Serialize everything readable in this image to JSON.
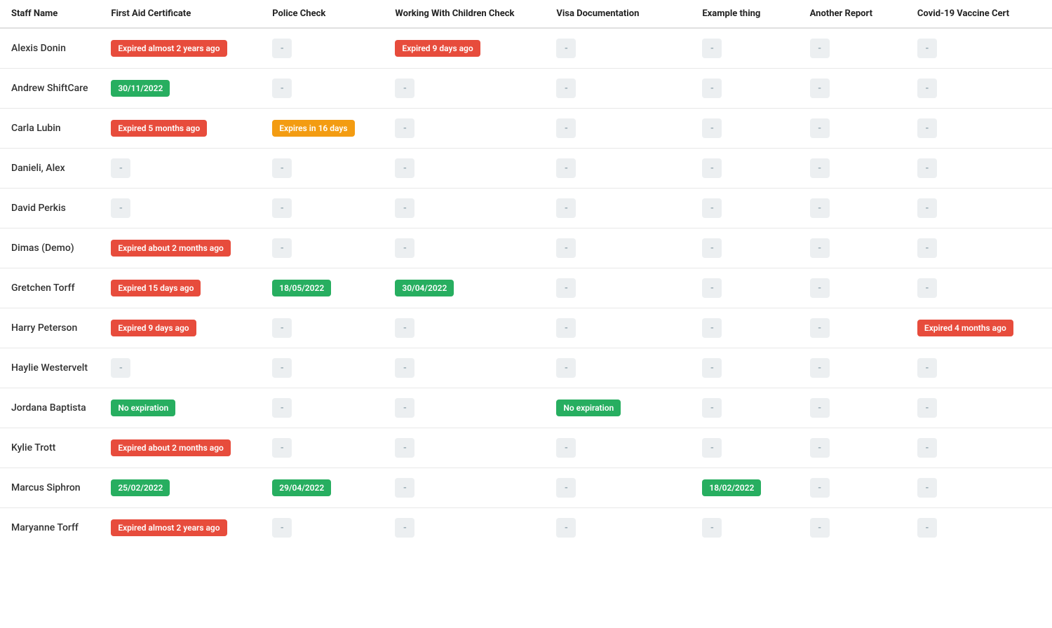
{
  "colors": {
    "red": "#e74c3c",
    "green": "#27ae60",
    "orange": "#f39c12",
    "empty_bg": "#eceff1",
    "empty_text": "#90a4ae"
  },
  "columns": [
    {
      "key": "name",
      "label": "Staff Name"
    },
    {
      "key": "first_aid",
      "label": "First Aid Certificate"
    },
    {
      "key": "police",
      "label": "Police Check"
    },
    {
      "key": "wwc",
      "label": "Working With Children Check"
    },
    {
      "key": "visa",
      "label": "Visa Documentation"
    },
    {
      "key": "example",
      "label": "Example thing"
    },
    {
      "key": "another",
      "label": "Another Report"
    },
    {
      "key": "covid",
      "label": "Covid-19 Vaccine Cert"
    }
  ],
  "rows": [
    {
      "name": "Alexis Donin",
      "first_aid": {
        "type": "red",
        "text": "Expired almost 2 years ago"
      },
      "police": {
        "type": "empty"
      },
      "wwc": {
        "type": "red",
        "text": "Expired 9 days ago"
      },
      "visa": {
        "type": "empty"
      },
      "example": {
        "type": "empty"
      },
      "another": {
        "type": "empty"
      },
      "covid": {
        "type": "empty"
      }
    },
    {
      "name": "Andrew ShiftCare",
      "first_aid": {
        "type": "green",
        "text": "30/11/2022"
      },
      "police": {
        "type": "empty"
      },
      "wwc": {
        "type": "empty"
      },
      "visa": {
        "type": "empty"
      },
      "example": {
        "type": "empty"
      },
      "another": {
        "type": "empty"
      },
      "covid": {
        "type": "empty"
      }
    },
    {
      "name": "Carla Lubin",
      "first_aid": {
        "type": "red",
        "text": "Expired 5 months ago"
      },
      "police": {
        "type": "orange",
        "text": "Expires in 16 days"
      },
      "wwc": {
        "type": "empty"
      },
      "visa": {
        "type": "empty"
      },
      "example": {
        "type": "empty"
      },
      "another": {
        "type": "empty"
      },
      "covid": {
        "type": "empty"
      }
    },
    {
      "name": "Danieli, Alex",
      "first_aid": {
        "type": "empty"
      },
      "police": {
        "type": "empty"
      },
      "wwc": {
        "type": "empty"
      },
      "visa": {
        "type": "empty"
      },
      "example": {
        "type": "empty"
      },
      "another": {
        "type": "empty"
      },
      "covid": {
        "type": "empty"
      }
    },
    {
      "name": "David Perkis",
      "first_aid": {
        "type": "empty"
      },
      "police": {
        "type": "empty"
      },
      "wwc": {
        "type": "empty"
      },
      "visa": {
        "type": "empty"
      },
      "example": {
        "type": "empty"
      },
      "another": {
        "type": "empty"
      },
      "covid": {
        "type": "empty"
      }
    },
    {
      "name": "Dimas (Demo)",
      "first_aid": {
        "type": "red",
        "text": "Expired about 2 months ago"
      },
      "police": {
        "type": "empty"
      },
      "wwc": {
        "type": "empty"
      },
      "visa": {
        "type": "empty"
      },
      "example": {
        "type": "empty"
      },
      "another": {
        "type": "empty"
      },
      "covid": {
        "type": "empty"
      }
    },
    {
      "name": "Gretchen Torff",
      "first_aid": {
        "type": "red",
        "text": "Expired 15 days ago"
      },
      "police": {
        "type": "green",
        "text": "18/05/2022"
      },
      "wwc": {
        "type": "green",
        "text": "30/04/2022"
      },
      "visa": {
        "type": "empty"
      },
      "example": {
        "type": "empty"
      },
      "another": {
        "type": "empty"
      },
      "covid": {
        "type": "empty"
      }
    },
    {
      "name": "Harry Peterson",
      "first_aid": {
        "type": "red",
        "text": "Expired 9 days ago"
      },
      "police": {
        "type": "empty"
      },
      "wwc": {
        "type": "empty"
      },
      "visa": {
        "type": "empty"
      },
      "example": {
        "type": "empty"
      },
      "another": {
        "type": "empty"
      },
      "covid": {
        "type": "red",
        "text": "Expired 4 months ago"
      }
    },
    {
      "name": "Haylie Westervelt",
      "first_aid": {
        "type": "empty"
      },
      "police": {
        "type": "empty"
      },
      "wwc": {
        "type": "empty"
      },
      "visa": {
        "type": "empty"
      },
      "example": {
        "type": "empty"
      },
      "another": {
        "type": "empty"
      },
      "covid": {
        "type": "empty"
      }
    },
    {
      "name": "Jordana Baptista",
      "first_aid": {
        "type": "green",
        "text": "No expiration"
      },
      "police": {
        "type": "empty"
      },
      "wwc": {
        "type": "empty"
      },
      "visa": {
        "type": "green",
        "text": "No expiration"
      },
      "example": {
        "type": "empty"
      },
      "another": {
        "type": "empty"
      },
      "covid": {
        "type": "empty"
      }
    },
    {
      "name": "Kylie Trott",
      "first_aid": {
        "type": "red",
        "text": "Expired about 2 months ago"
      },
      "police": {
        "type": "empty"
      },
      "wwc": {
        "type": "empty"
      },
      "visa": {
        "type": "empty"
      },
      "example": {
        "type": "empty"
      },
      "another": {
        "type": "empty"
      },
      "covid": {
        "type": "empty"
      }
    },
    {
      "name": "Marcus Siphron",
      "first_aid": {
        "type": "green",
        "text": "25/02/2022"
      },
      "police": {
        "type": "green",
        "text": "29/04/2022"
      },
      "wwc": {
        "type": "empty"
      },
      "visa": {
        "type": "empty"
      },
      "example": {
        "type": "green",
        "text": "18/02/2022"
      },
      "another": {
        "type": "empty"
      },
      "covid": {
        "type": "empty"
      }
    },
    {
      "name": "Maryanne Torff",
      "first_aid": {
        "type": "red",
        "text": "Expired almost 2 years ago"
      },
      "police": {
        "type": "empty"
      },
      "wwc": {
        "type": "empty"
      },
      "visa": {
        "type": "empty"
      },
      "example": {
        "type": "empty"
      },
      "another": {
        "type": "empty"
      },
      "covid": {
        "type": "empty"
      }
    }
  ]
}
